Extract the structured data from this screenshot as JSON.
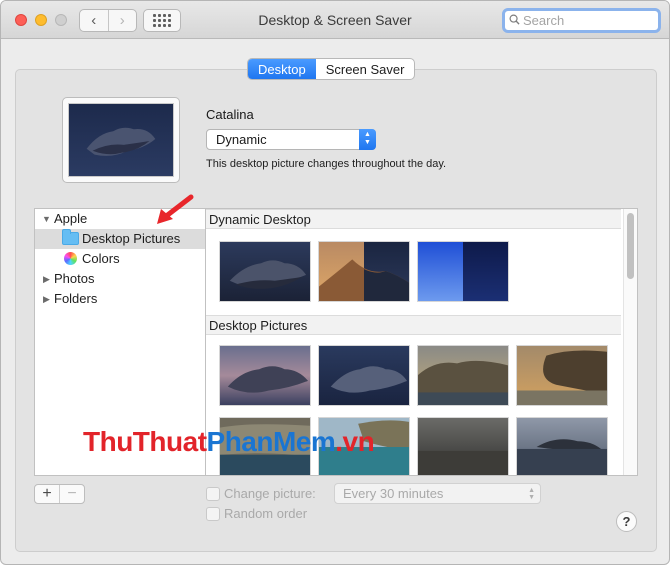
{
  "window": {
    "title": "Desktop & Screen Saver",
    "search_placeholder": "Search",
    "back_glyph": "‹",
    "forward_glyph": "›"
  },
  "tabs": [
    {
      "label": "Desktop",
      "active": true
    },
    {
      "label": "Screen Saver",
      "active": false
    }
  ],
  "current_picture": {
    "name": "Catalina",
    "mode": "Dynamic",
    "description": "This desktop picture changes throughout the day."
  },
  "sidebar": {
    "items": [
      {
        "label": "Apple",
        "disclosure": "▼",
        "expanded": true
      },
      {
        "label": "Desktop Pictures",
        "icon": "folder-icon",
        "selected": true
      },
      {
        "label": "Colors",
        "icon": "color-wheel-icon"
      },
      {
        "label": "Photos",
        "disclosure": "▶"
      },
      {
        "label": "Folders",
        "disclosure": "▶"
      }
    ]
  },
  "gallery": {
    "sections": [
      {
        "title": "Dynamic Desktop",
        "thumbnails": [
          "catalina-dynamic",
          "mojave-dunes-dynamic",
          "blue-gradient-dynamic"
        ]
      },
      {
        "title": "Desktop Pictures",
        "thumbnails": [
          "catalina-evening",
          "catalina-island",
          "catalina-cliffs-dusk",
          "catalina-cliffs-sunset",
          "catalina-rocks",
          "catalina-coast-aerial",
          "catalina-clouds-sea",
          "catalina-storm-island"
        ]
      }
    ]
  },
  "controls": {
    "add_label": "+",
    "remove_label": "−",
    "change_picture_label": "Change picture:",
    "change_picture_checked": false,
    "interval_value": "Every 30 minutes",
    "random_order_label": "Random order",
    "random_order_checked": false,
    "help_label": "?"
  },
  "watermark": {
    "part1": "ThuThuat",
    "part2": "PhanMem",
    "part3": ".vn"
  },
  "colors": {
    "accent": "#1f76f0",
    "watermark_red": "#e2242a",
    "watermark_blue": "#1a75d2",
    "arrow_red": "#e8262b"
  }
}
